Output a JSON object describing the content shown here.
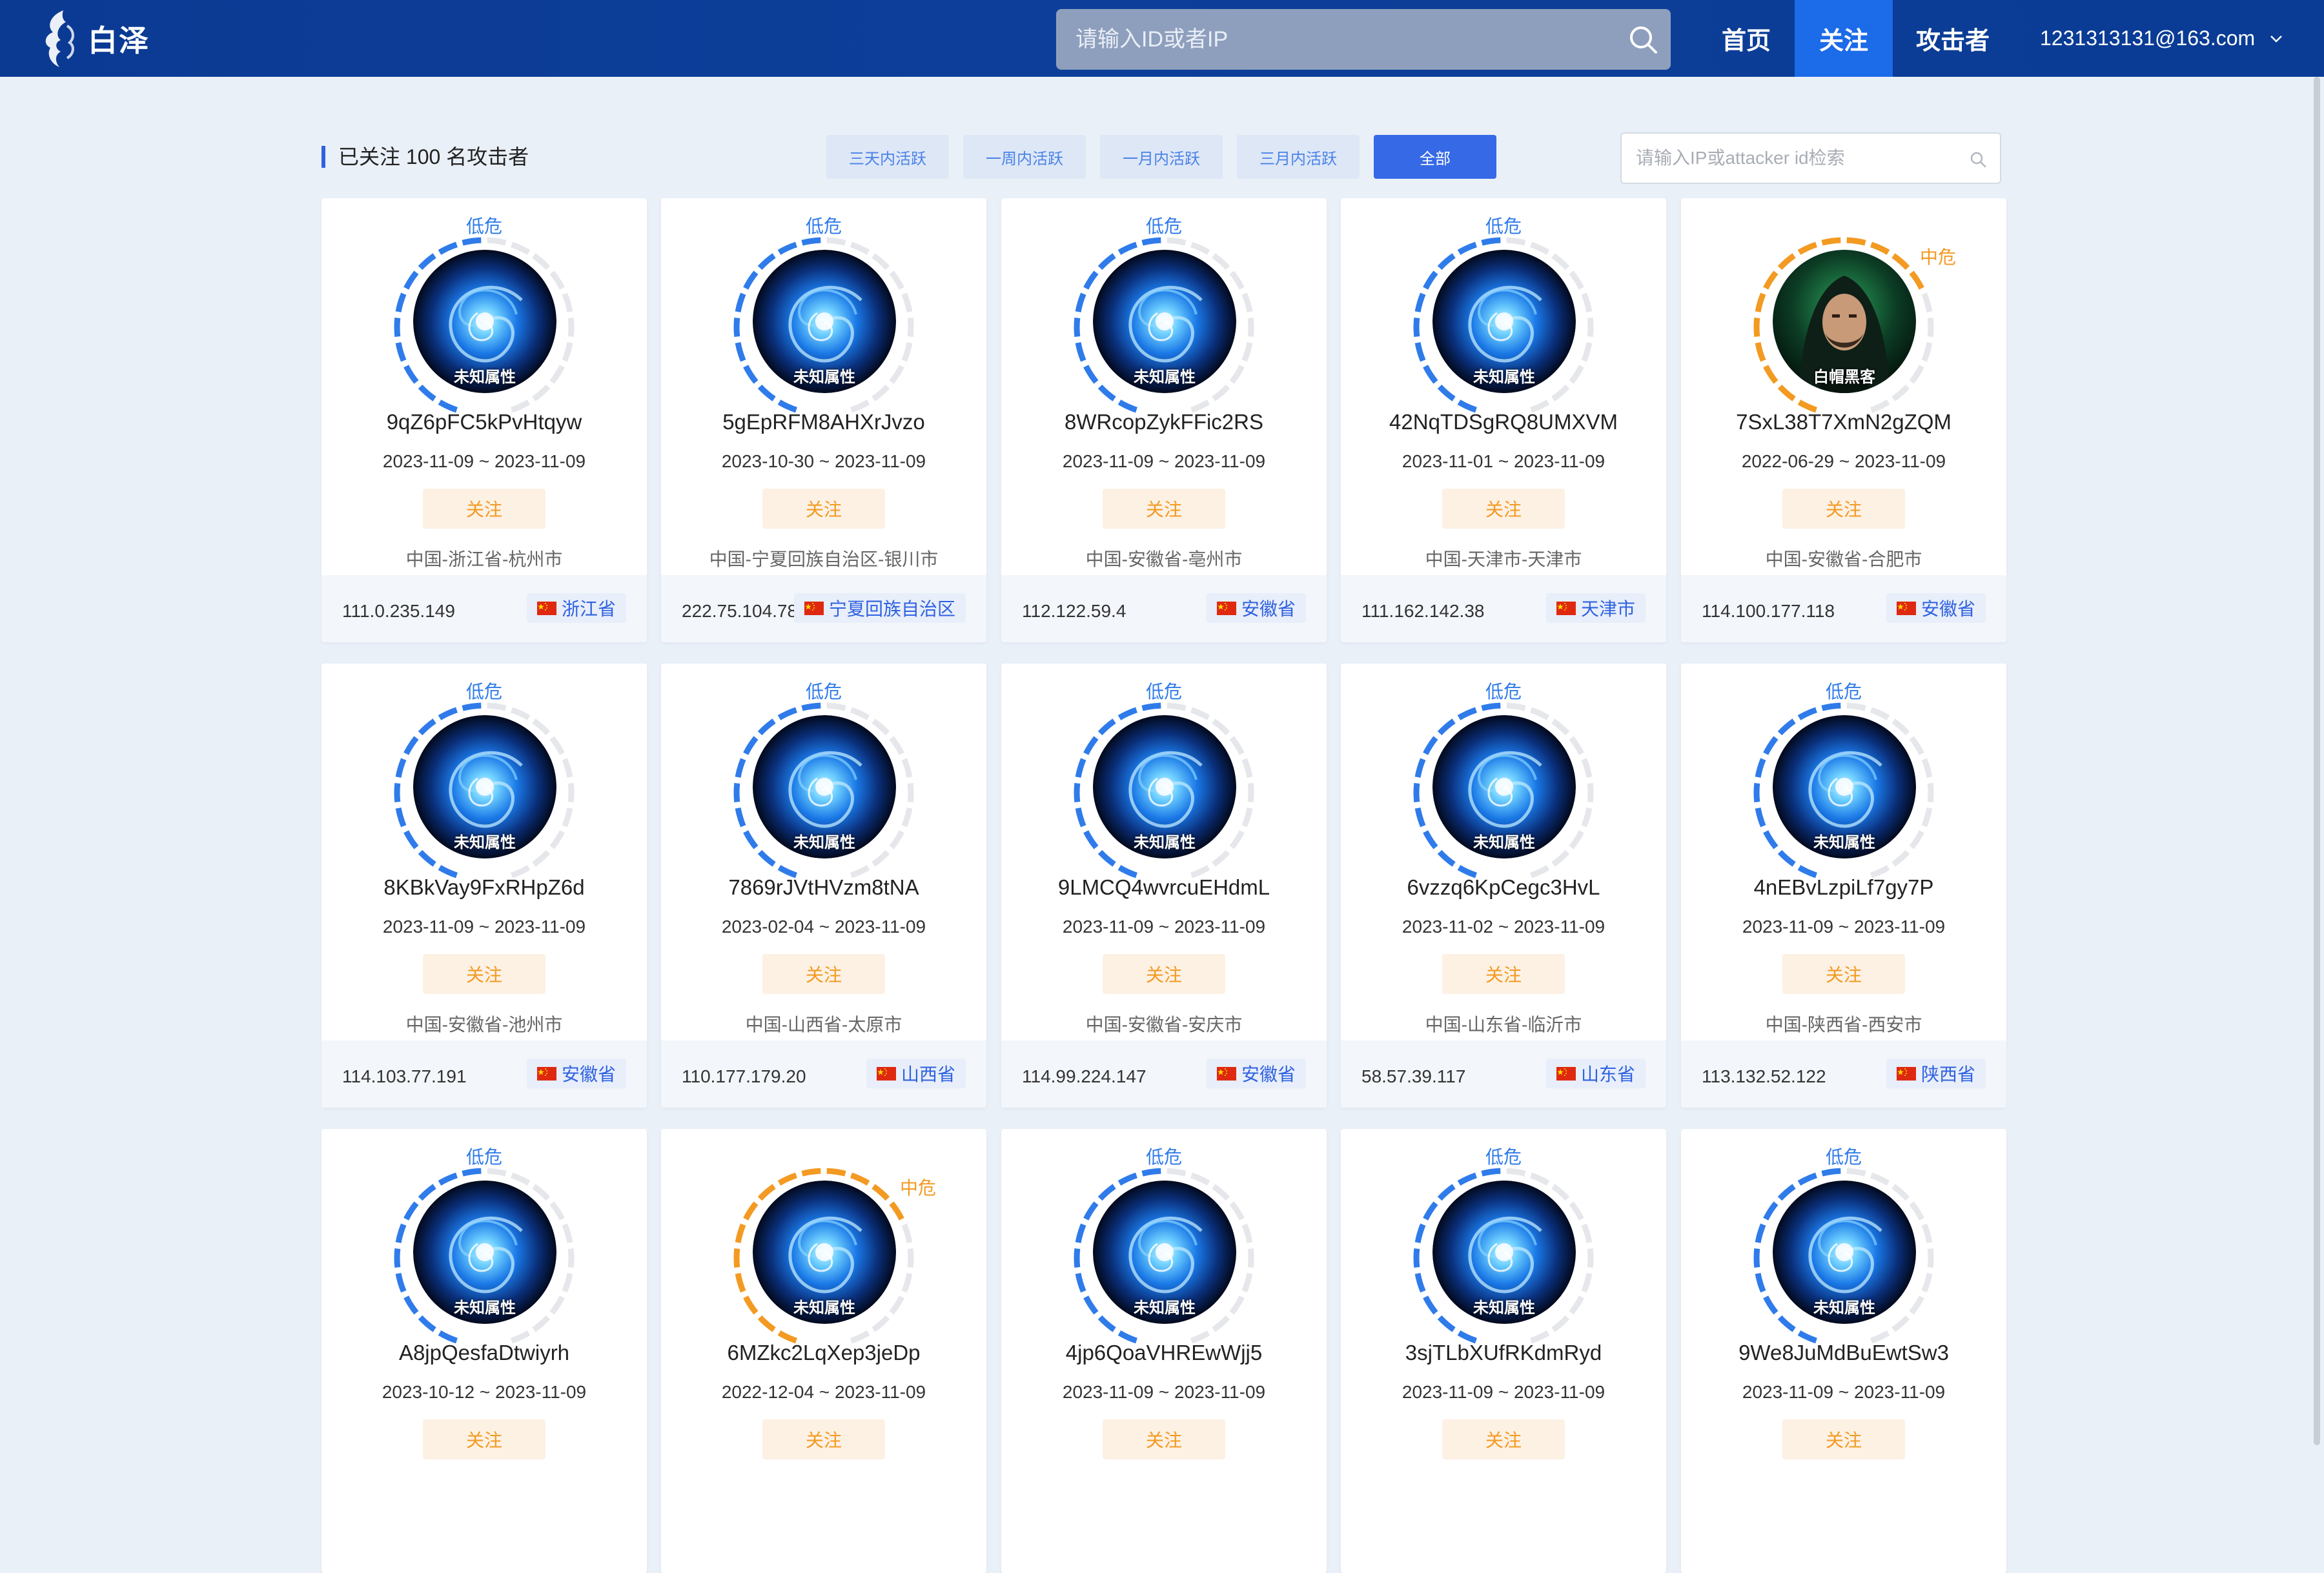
{
  "header": {
    "logo_text": "白泽",
    "search_placeholder": "请输入ID或者IP",
    "nav": {
      "home": "首页",
      "follow": "关注",
      "attacker": "攻击者"
    },
    "user_email": "1231313131@163.com",
    "active_nav": "关注"
  },
  "toolbar": {
    "title": "已关注 100 名攻击者",
    "filters": [
      "三天内活跃",
      "一周内活跃",
      "一月内活跃",
      "三月内活跃",
      "全部"
    ],
    "active_filter": "全部",
    "search_placeholder": "请输入IP或attacker id检索"
  },
  "colors": {
    "accent": "#3569e6",
    "low_risk": "#2f7bea",
    "mid_risk": "#f39a22",
    "header": "#0b3a93"
  },
  "follow_label": "关注",
  "attackers": [
    {
      "id": "9qZ6pFC5kPvHtqyw",
      "dates": "2023-11-09 ~ 2023-11-09",
      "risk": "低危",
      "risk_level": "low",
      "avatar": "vortex-avatar",
      "attribute": "未知属性",
      "location": "中国-浙江省-杭州市",
      "ip": "111.0.235.149",
      "province": "浙江省"
    },
    {
      "id": "5gEpRFM8AHXrJvzo",
      "dates": "2023-10-30 ~ 2023-11-09",
      "risk": "低危",
      "risk_level": "low",
      "avatar": "vortex-avatar",
      "attribute": "未知属性",
      "location": "中国-宁夏回族自治区-银川市",
      "ip": "222.75.104.78",
      "province": "宁夏回族自治区"
    },
    {
      "id": "8WRcopZykFFic2RS",
      "dates": "2023-11-09 ~ 2023-11-09",
      "risk": "低危",
      "risk_level": "low",
      "avatar": "vortex-avatar",
      "attribute": "未知属性",
      "location": "中国-安徽省-亳州市",
      "ip": "112.122.59.4",
      "province": "安徽省"
    },
    {
      "id": "42NqTDSgRQ8UMXVM",
      "dates": "2023-11-01 ~ 2023-11-09",
      "risk": "低危",
      "risk_level": "low",
      "avatar": "vortex-avatar",
      "attribute": "未知属性",
      "location": "中国-天津市-天津市",
      "ip": "111.162.142.38",
      "province": "天津市"
    },
    {
      "id": "7SxL38T7XmN2gZQM",
      "dates": "2022-06-29 ~ 2023-11-09",
      "risk": "中危",
      "risk_level": "mid",
      "avatar": "hacker-avatar",
      "attribute": "白帽黑客",
      "location": "中国-安徽省-合肥市",
      "ip": "114.100.177.118",
      "province": "安徽省"
    },
    {
      "id": "8KBkVay9FxRHpZ6d",
      "dates": "2023-11-09 ~ 2023-11-09",
      "risk": "低危",
      "risk_level": "low",
      "avatar": "vortex-avatar",
      "attribute": "未知属性",
      "location": "中国-安徽省-池州市",
      "ip": "114.103.77.191",
      "province": "安徽省"
    },
    {
      "id": "7869rJVtHVzm8tNA",
      "dates": "2023-02-04 ~ 2023-11-09",
      "risk": "低危",
      "risk_level": "low",
      "avatar": "vortex-avatar",
      "attribute": "未知属性",
      "location": "中国-山西省-太原市",
      "ip": "110.177.179.20",
      "province": "山西省"
    },
    {
      "id": "9LMCQ4wvrcuEHdmL",
      "dates": "2023-11-09 ~ 2023-11-09",
      "risk": "低危",
      "risk_level": "low",
      "avatar": "vortex-avatar",
      "attribute": "未知属性",
      "location": "中国-安徽省-安庆市",
      "ip": "114.99.224.147",
      "province": "安徽省"
    },
    {
      "id": "6vzzq6KpCegc3HvL",
      "dates": "2023-11-02 ~ 2023-11-09",
      "risk": "低危",
      "risk_level": "low",
      "avatar": "vortex-avatar",
      "attribute": "未知属性",
      "location": "中国-山东省-临沂市",
      "ip": "58.57.39.117",
      "province": "山东省"
    },
    {
      "id": "4nEBvLzpiLf7gy7P",
      "dates": "2023-11-09 ~ 2023-11-09",
      "risk": "低危",
      "risk_level": "low",
      "avatar": "vortex-avatar",
      "attribute": "未知属性",
      "location": "中国-陕西省-西安市",
      "ip": "113.132.52.122",
      "province": "陕西省"
    },
    {
      "id": "A8jpQesfaDtwiyrh",
      "dates": "2023-10-12 ~ 2023-11-09",
      "risk": "低危",
      "risk_level": "low",
      "avatar": "vortex-avatar",
      "attribute": "未知属性"
    },
    {
      "id": "6MZkc2LqXep3jeDp",
      "dates": "2022-12-04 ~ 2023-11-09",
      "risk": "中危",
      "risk_level": "mid",
      "avatar": "vortex-avatar",
      "attribute": "未知属性"
    },
    {
      "id": "4jp6QoaVHREwWjj5",
      "dates": "2023-11-09 ~ 2023-11-09",
      "risk": "低危",
      "risk_level": "low",
      "avatar": "vortex-avatar",
      "attribute": "未知属性"
    },
    {
      "id": "3sjTLbXUfRKdmRyd",
      "dates": "2023-11-09 ~ 2023-11-09",
      "risk": "低危",
      "risk_level": "low",
      "avatar": "vortex-avatar",
      "attribute": "未知属性"
    },
    {
      "id": "9We8JuMdBuEwtSw3",
      "dates": "2023-11-09 ~ 2023-11-09",
      "risk": "低危",
      "risk_level": "low",
      "avatar": "vortex-avatar",
      "attribute": "未知属性"
    }
  ]
}
